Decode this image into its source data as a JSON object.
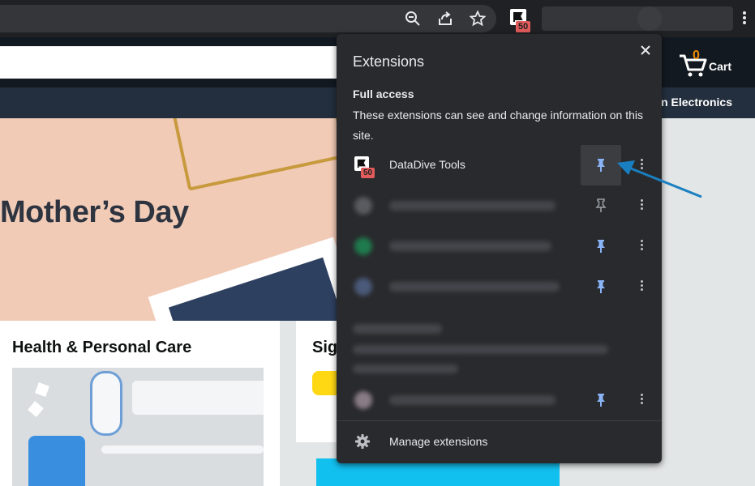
{
  "browser": {
    "toolbar_icons": [
      "zoom-icon",
      "share-icon",
      "bookmark-star-icon"
    ],
    "extension_button": {
      "badge": "50"
    }
  },
  "amazon": {
    "cart": {
      "count": "0",
      "label": "Cart"
    },
    "nav": {
      "electronics": "n Electronics"
    },
    "hero": {
      "title": "Mother’s Day"
    },
    "cards": [
      {
        "title": "Health & Personal Care"
      },
      {
        "title": "Sig"
      }
    ]
  },
  "extensions_popup": {
    "title": "Extensions",
    "section_title": "Full access",
    "section_description": "These extensions can see and change information on this site.",
    "extensions": [
      {
        "name": "DataDive Tools",
        "badge": "50",
        "pinned": true,
        "highlighted": true
      }
    ],
    "manage_label": "Manage extensions"
  },
  "colors": {
    "pin_active": "#8ab4f8",
    "pin_inactive": "#9aa0a6",
    "annotation_arrow": "#1a7fc1",
    "badge": "#e25c5c"
  }
}
